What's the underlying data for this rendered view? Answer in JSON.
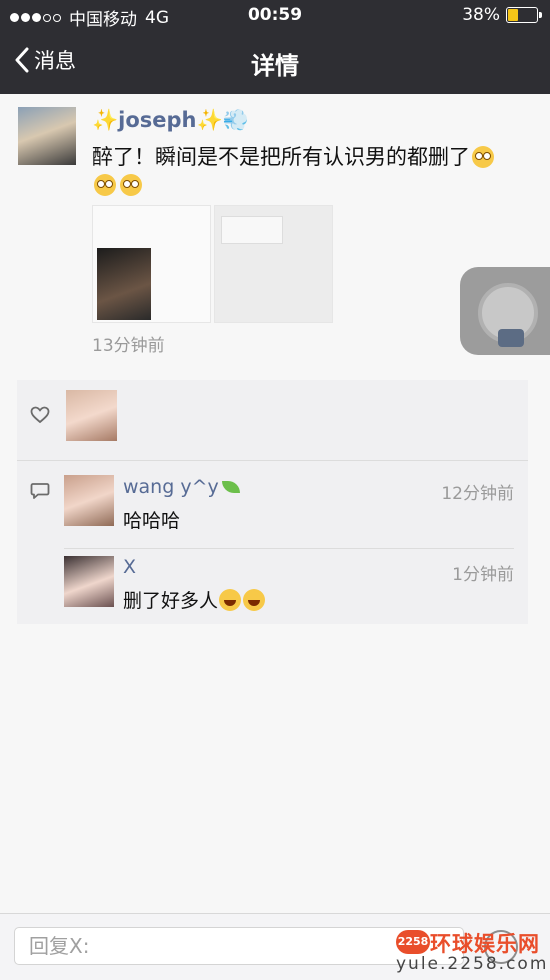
{
  "status_bar": {
    "carrier": "中国移动",
    "network": "4G",
    "time": "00:59",
    "battery": "38%",
    "battery_level": 0.38,
    "battery_color": "#f5c518"
  },
  "nav": {
    "back_label": "消息",
    "title": "详情"
  },
  "post": {
    "author": "joseph",
    "text": "醉了！瞬间是不是把所有认识男的都删了",
    "time": "13分钟前"
  },
  "likes": {
    "icon": "heart-outline-icon"
  },
  "comments": [
    {
      "name": "wang y^y",
      "time": "12分钟前",
      "text": "哈哈哈"
    },
    {
      "name": "X",
      "time": "1分钟前",
      "text": "删了好多人"
    }
  ],
  "reply": {
    "placeholder": "回复X:"
  },
  "watermark": {
    "badge": "2258",
    "title": "环球娱乐网",
    "url": "yule.2258.com"
  },
  "colors": {
    "header_bg": "#2e2e33",
    "name_link": "#576b95",
    "page_bg": "#f7f7f7",
    "watermark_red": "#e94e2b"
  }
}
